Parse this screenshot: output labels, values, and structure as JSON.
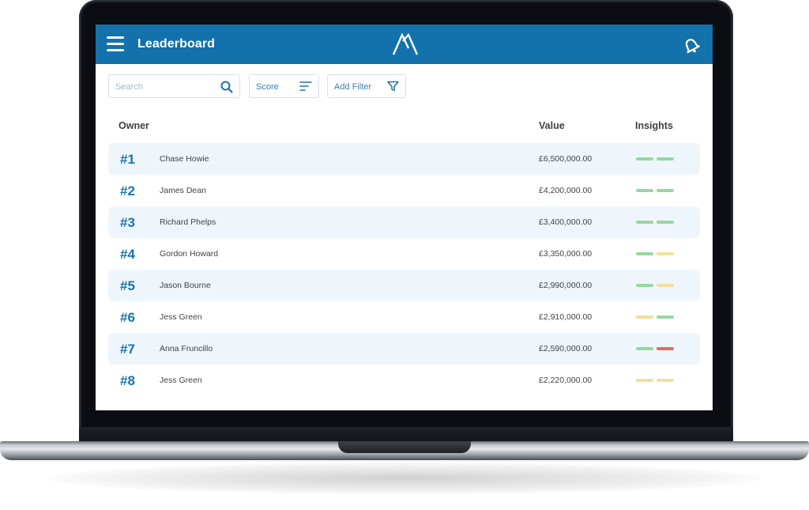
{
  "header": {
    "title": "Leaderboard",
    "menu_icon": "hamburger-menu-icon",
    "logo_icon": "brand-logo-icon",
    "notification_icon": "bell-icon",
    "color": "#1371ab"
  },
  "controls": {
    "search_placeholder": "Search",
    "search_icon": "search-icon",
    "sort_label": "Score",
    "sort_icon": "sort-lines-icon",
    "filter_label": "Add Filter",
    "filter_icon": "funnel-icon"
  },
  "table": {
    "columns": [
      "Owner",
      "Value",
      "Insights"
    ],
    "insight_colors": {
      "green": "#97d7a0",
      "yellow": "#f1e0a0",
      "red": "#e46a63"
    },
    "rows": [
      {
        "rank": "#1",
        "name": "Chase Howie",
        "value": "£6,500,000.00",
        "insights": [
          "green",
          "green"
        ]
      },
      {
        "rank": "#2",
        "name": "James Dean",
        "value": "£4,200,000.00",
        "insights": [
          "green",
          "green"
        ]
      },
      {
        "rank": "#3",
        "name": "Richard Phelps",
        "value": "£3,400,000.00",
        "insights": [
          "green",
          "green"
        ]
      },
      {
        "rank": "#4",
        "name": "Gordon Howard",
        "value": "£3,350,000.00",
        "insights": [
          "green",
          "yellow"
        ]
      },
      {
        "rank": "#5",
        "name": "Jason Bourne",
        "value": "£2,990,000.00",
        "insights": [
          "green",
          "yellow"
        ]
      },
      {
        "rank": "#6",
        "name": "Jess Green",
        "value": "£2,910,000.00",
        "insights": [
          "yellow",
          "green"
        ]
      },
      {
        "rank": "#7",
        "name": "Anna Fruncillo",
        "value": "£2,590,000.00",
        "insights": [
          "green",
          "red"
        ]
      },
      {
        "rank": "#8",
        "name": "Jess Green",
        "value": "£2,220,000.00",
        "insights": [
          "yellow",
          "yellow"
        ]
      }
    ]
  }
}
